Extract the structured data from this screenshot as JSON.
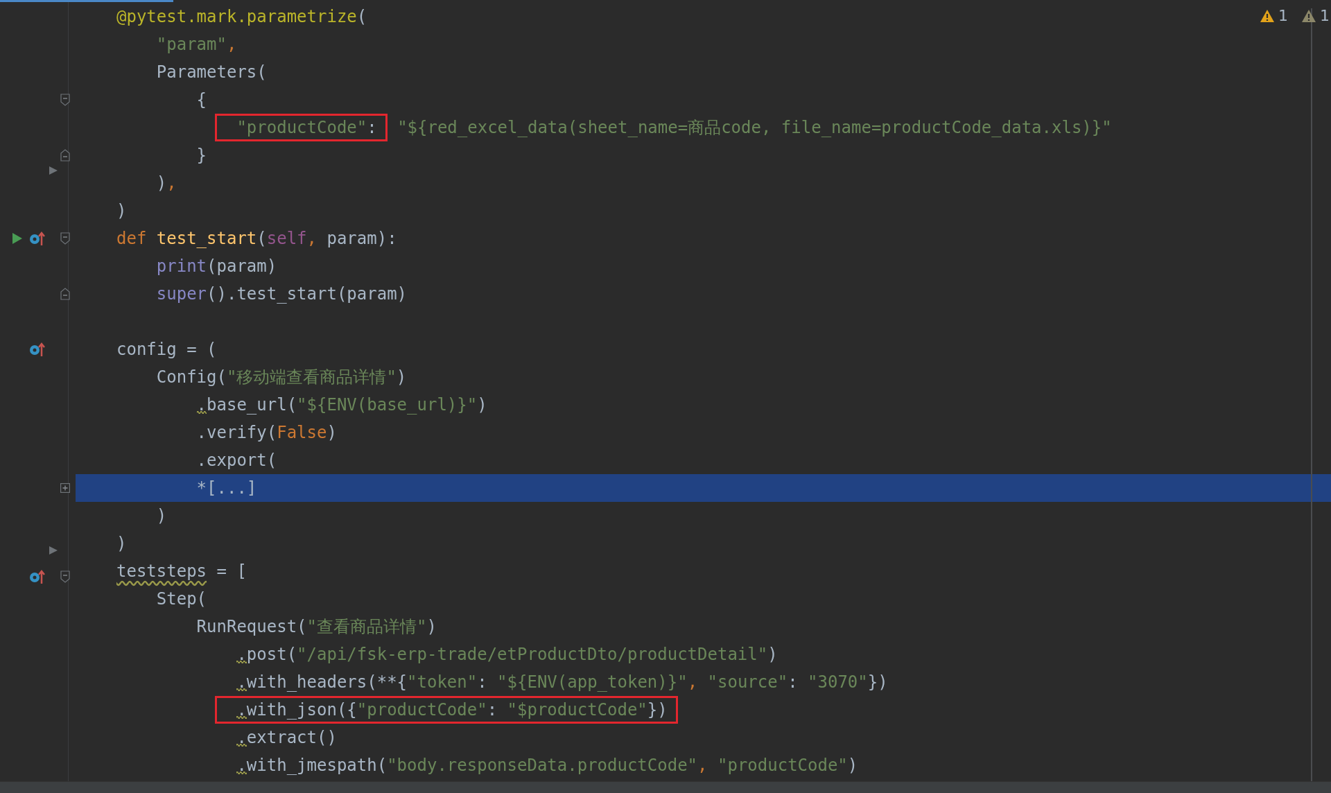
{
  "editor": {
    "inspections": [
      {
        "kind": "warning",
        "count": "1"
      },
      {
        "kind": "weak_warning",
        "count": "1"
      }
    ],
    "lines": [
      {
        "highlighted": false,
        "segments": [
          {
            "tokens": [
              {
                "kind": "decorator",
                "text": "@pytest.mark.parametrize"
              },
              {
                "kind": "plain",
                "text": "("
              }
            ]
          }
        ]
      },
      {
        "highlighted": false,
        "segments": [
          {
            "tokens": [
              {
                "kind": "string",
                "text": "    \"param\""
              },
              {
                "kind": "separator",
                "text": ","
              }
            ]
          }
        ]
      },
      {
        "highlighted": false,
        "segments": [
          {
            "tokens": [
              {
                "kind": "plain",
                "text": "    Parameters("
              }
            ]
          }
        ]
      },
      {
        "highlighted": false,
        "gutter_icons": [
          {
            "kind": "fold_start"
          }
        ],
        "segments": [
          {
            "tokens": [
              {
                "kind": "plain",
                "text": "        {"
              }
            ]
          }
        ]
      },
      {
        "highlighted": false,
        "segments": [
          {
            "boxed": true,
            "tokens": [
              {
                "kind": "string",
                "text": "            \"productCode\""
              },
              {
                "kind": "plain",
                "text": ":"
              }
            ]
          },
          {
            "tokens": [
              {
                "kind": "string",
                "text": " \"${red_excel_data(sheet_name=商品code, file_name=productCode_data.xls)}\""
              }
            ]
          }
        ]
      },
      {
        "highlighted": false,
        "gutter_icons": [
          {
            "kind": "fold_end"
          }
        ],
        "segments": [
          {
            "tokens": [
              {
                "kind": "plain",
                "text": "        }"
              }
            ]
          }
        ]
      },
      {
        "highlighted": false,
        "gutter_icons": [
          {
            "kind": "pointer"
          }
        ],
        "segments": [
          {
            "tokens": [
              {
                "kind": "plain",
                "text": "    )"
              },
              {
                "kind": "separator",
                "text": ","
              }
            ]
          }
        ]
      },
      {
        "highlighted": false,
        "segments": [
          {
            "tokens": [
              {
                "kind": "plain",
                "text": ")"
              }
            ]
          }
        ]
      },
      {
        "highlighted": false,
        "gutter_icons": [
          {
            "kind": "run"
          },
          {
            "kind": "override"
          },
          {
            "kind": "fold_start"
          }
        ],
        "segments": [
          {
            "tokens": [
              {
                "kind": "keyword",
                "text": "def"
              },
              {
                "kind": "function",
                "text": " test_start"
              },
              {
                "kind": "plain",
                "text": "("
              },
              {
                "kind": "self",
                "text": "self"
              },
              {
                "kind": "separator",
                "text": ","
              },
              {
                "kind": "plain",
                "text": " param):"
              }
            ]
          }
        ]
      },
      {
        "highlighted": false,
        "segments": [
          {
            "tokens": [
              {
                "kind": "builtin",
                "text": "    print"
              },
              {
                "kind": "plain",
                "text": "(param)"
              }
            ]
          }
        ]
      },
      {
        "highlighted": false,
        "gutter_icons": [
          {
            "kind": "fold_end"
          }
        ],
        "segments": [
          {
            "tokens": [
              {
                "kind": "builtin",
                "text": "    super"
              },
              {
                "kind": "plain",
                "text": "().test_start(param)"
              }
            ]
          }
        ]
      },
      {
        "highlighted": false
      },
      {
        "highlighted": false,
        "gutter_icons": [
          {
            "kind": "override"
          }
        ],
        "segments": [
          {
            "tokens": [
              {
                "kind": "plain",
                "text": "config = ("
              }
            ]
          }
        ]
      },
      {
        "highlighted": false,
        "segments": [
          {
            "tokens": [
              {
                "kind": "plain",
                "text": "    Config("
              },
              {
                "kind": "string",
                "text": "\"移动端查看商品详情\""
              },
              {
                "kind": "plain",
                "text": ")"
              }
            ]
          }
        ]
      },
      {
        "highlighted": false,
        "segments": [
          {
            "tokens": [
              {
                "kind": "plain",
                "text": "        .base_url(",
                "wavy_first": true
              },
              {
                "kind": "string",
                "text": "\"${ENV(base_url)}\""
              },
              {
                "kind": "plain",
                "text": ")"
              }
            ]
          }
        ]
      },
      {
        "highlighted": false,
        "segments": [
          {
            "tokens": [
              {
                "kind": "plain",
                "text": "        .verify("
              },
              {
                "kind": "keyword",
                "text": "False"
              },
              {
                "kind": "plain",
                "text": ")"
              }
            ]
          }
        ]
      },
      {
        "highlighted": false,
        "segments": [
          {
            "tokens": [
              {
                "kind": "plain",
                "text": "        .export("
              }
            ]
          }
        ]
      },
      {
        "highlighted": true,
        "gutter_icons": [
          {
            "kind": "fold_collapsed"
          }
        ],
        "segments": [
          {
            "tokens": [
              {
                "kind": "plain",
                "text": "        *[...]"
              }
            ]
          }
        ]
      },
      {
        "highlighted": false,
        "segments": [
          {
            "tokens": [
              {
                "kind": "plain",
                "text": "    )"
              }
            ]
          }
        ]
      },
      {
        "highlighted": false,
        "segments": [
          {
            "tokens": [
              {
                "kind": "plain",
                "text": ")"
              }
            ]
          }
        ]
      },
      {
        "highlighted": false,
        "gutter_icons": [
          {
            "kind": "pointer"
          },
          {
            "kind": "override"
          },
          {
            "kind": "fold_start"
          }
        ],
        "segments": [
          {
            "tokens": [
              {
                "kind": "plain",
                "text": "teststeps",
                "wavy": true
              },
              {
                "kind": "plain",
                "text": " = ["
              }
            ]
          }
        ]
      },
      {
        "highlighted": false,
        "segments": [
          {
            "tokens": [
              {
                "kind": "plain",
                "text": "    Step("
              }
            ]
          }
        ]
      },
      {
        "highlighted": false,
        "segments": [
          {
            "tokens": [
              {
                "kind": "plain",
                "text": "        RunRequest("
              },
              {
                "kind": "string",
                "text": "\"查看商品详情\""
              },
              {
                "kind": "plain",
                "text": ")"
              }
            ]
          }
        ]
      },
      {
        "highlighted": false,
        "segments": [
          {
            "tokens": [
              {
                "kind": "plain",
                "text": "            .post(",
                "wavy_first": true
              },
              {
                "kind": "string",
                "text": "\"/api/fsk-erp-trade/etProductDto/productDetail\""
              },
              {
                "kind": "plain",
                "text": ")"
              }
            ]
          }
        ]
      },
      {
        "highlighted": false,
        "segments": [
          {
            "tokens": [
              {
                "kind": "plain",
                "text": "            .with_headers(**{",
                "wavy_first": true
              },
              {
                "kind": "string",
                "text": "\"token\""
              },
              {
                "kind": "plain",
                "text": ": "
              },
              {
                "kind": "string",
                "text": "\"${ENV(app_token)}\""
              },
              {
                "kind": "separator",
                "text": ","
              },
              {
                "kind": "string",
                "text": " \"source\""
              },
              {
                "kind": "plain",
                "text": ": "
              },
              {
                "kind": "string",
                "text": "\"3070\""
              },
              {
                "kind": "plain",
                "text": "})"
              }
            ]
          }
        ]
      },
      {
        "highlighted": false,
        "segments": [
          {
            "boxed": true,
            "tokens": [
              {
                "kind": "plain",
                "text": "            .with_json({",
                "wavy_first": true
              },
              {
                "kind": "string",
                "text": "\"productCode\""
              },
              {
                "kind": "plain",
                "text": ": "
              },
              {
                "kind": "string",
                "text": "\"$productCode\""
              },
              {
                "kind": "plain",
                "text": "})"
              }
            ]
          }
        ]
      },
      {
        "highlighted": false,
        "segments": [
          {
            "tokens": [
              {
                "kind": "plain",
                "text": "            .extract()",
                "wavy_first": true
              }
            ]
          }
        ]
      },
      {
        "highlighted": false,
        "segments": [
          {
            "tokens": [
              {
                "kind": "plain",
                "text": "            .with_jmespath(",
                "wavy_first": true
              },
              {
                "kind": "string",
                "text": "\"body.responseData.productCode\""
              },
              {
                "kind": "separator",
                "text": ","
              },
              {
                "kind": "string",
                "text": " \"productCode\""
              },
              {
                "kind": "plain",
                "text": ")"
              }
            ]
          }
        ]
      }
    ]
  }
}
